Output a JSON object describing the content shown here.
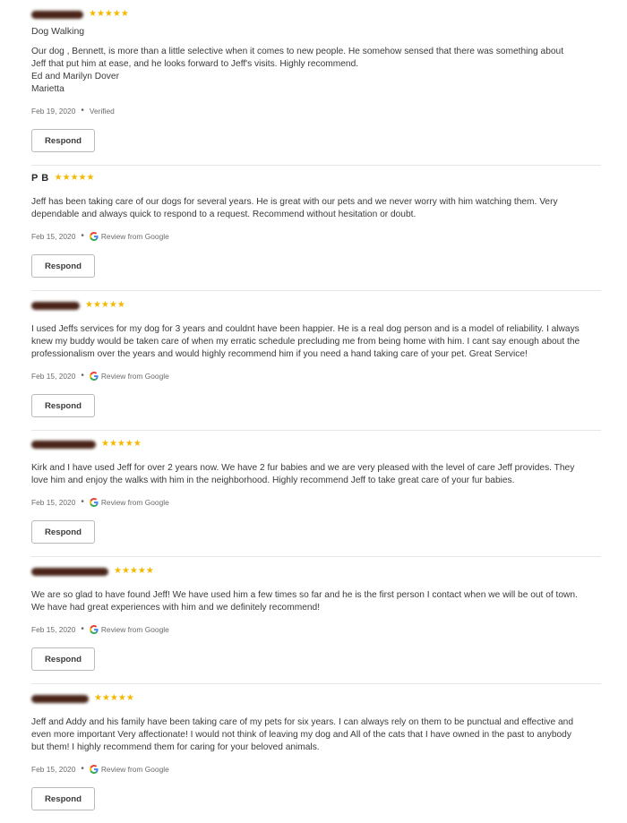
{
  "reviews": [
    {
      "name": "",
      "redacted": true,
      "stars": "★★★★★",
      "subtitle": "Dog Walking",
      "lines": [
        "Our dog , Bennett, is more than a little selective when it comes to new people. He somehow sensed that there was something about",
        "Jeff that put him at ease, and he looks forward to Jeff's visits. Highly recommend.",
        "Ed and Marilyn Dover",
        "Marietta"
      ],
      "date": "Feb 19, 2020",
      "dot": "•",
      "source": "Verified",
      "google": false,
      "respond": "Respond"
    },
    {
      "name": "P B",
      "redacted": false,
      "stars": "★★★★★",
      "subtitle": "",
      "lines": [
        "Jeff has been taking care of our dogs for several years. He is great with our pets and we never worry with him watching them. Very",
        "dependable and always quick to respond to a request. Recommend without hesitation or doubt."
      ],
      "date": "Feb 15, 2020",
      "dot": "•",
      "source": "Review from Google",
      "google": true,
      "respond": "Respond"
    },
    {
      "name": "",
      "redacted": true,
      "stars": "★★★★★",
      "subtitle": "",
      "lines": [
        "I used Jeffs services for my dog for 3 years and couldnt have been happier. He is a real dog person and is a model of reliability. I always",
        "knew my buddy would be taken care of when my erratic schedule precluding me from being home with him. I cant say enough about the",
        "professionalism over the years and would highly recommend him if you need a hand taking care of your pet. Great Service!"
      ],
      "date": "Feb 15, 2020",
      "dot": "•",
      "source": "Review from Google",
      "google": true,
      "respond": "Respond"
    },
    {
      "name": "",
      "redacted": true,
      "stars": "★★★★★",
      "subtitle": "",
      "lines": [
        "Kirk and I have used Jeff for over 2 years now. We have 2 fur babies and we are very pleased with the level of care Jeff provides. They",
        "love him and enjoy the walks with him in the neighborhood. Highly recommend Jeff to take great care of your fur babies."
      ],
      "date": "Feb 15, 2020",
      "dot": "•",
      "source": "Review from Google",
      "google": true,
      "respond": "Respond"
    },
    {
      "name": "",
      "redacted": true,
      "stars": "★★★★★",
      "subtitle": "",
      "lines": [
        "We are so glad to have found Jeff! We have used him a few times so far and he is the first person I contact when we will be out of town.",
        "We have had great experiences with him and we definitely recommend!"
      ],
      "date": "Feb 15, 2020",
      "dot": "•",
      "source": "Review from Google",
      "google": true,
      "respond": "Respond"
    },
    {
      "name": "",
      "redacted": true,
      "stars": "★★★★★",
      "subtitle": "",
      "lines": [
        "Jeff and Addy and his family have been taking care of my pets for six years. I can always rely on them to be punctual and effective and",
        "even more important Very affectionate! I would not think of leaving my dog and All of the cats that I have owned in the past to anybody",
        "but them! I highly recommend them for caring for your beloved animals."
      ],
      "date": "Feb 15, 2020",
      "dot": "•",
      "source": "Review from Google",
      "google": true,
      "respond": "Respond"
    }
  ]
}
